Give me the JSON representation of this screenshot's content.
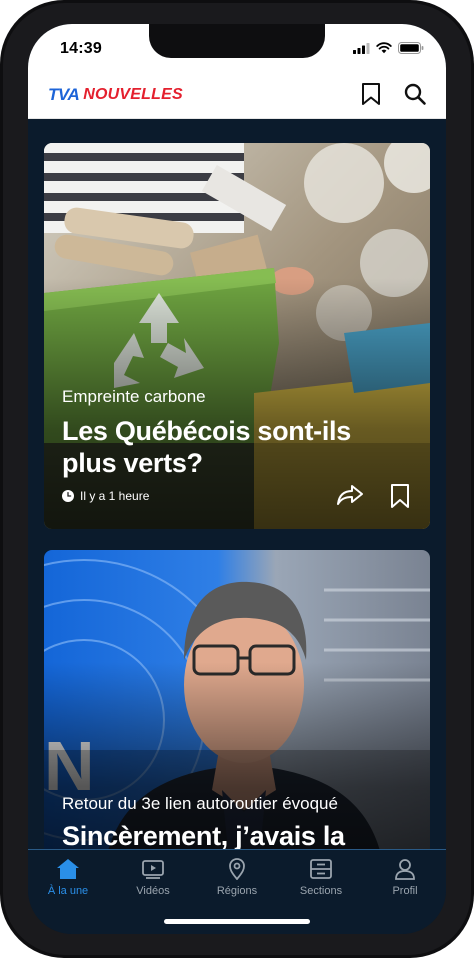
{
  "status": {
    "time": "14:39"
  },
  "brand": {
    "tva": "TVA",
    "nouvelles": "NOUVELLES"
  },
  "appbar": {
    "bookmark_icon": "bookmark-icon",
    "search_icon": "search-icon"
  },
  "articles": [
    {
      "kicker": "Empreinte carbone",
      "title": "Les Québécois sont-ils plus verts?",
      "time_ago": "Il y a 1 heure"
    },
    {
      "kicker": "Retour du 3e lien autoroutier évoqué",
      "title": "Sincèrement, j’avais la"
    }
  ],
  "tabs": [
    {
      "label": "À la une",
      "icon": "home-icon",
      "active": true
    },
    {
      "label": "Vidéos",
      "icon": "video-icon"
    },
    {
      "label": "Régions",
      "icon": "location-pin-icon"
    },
    {
      "label": "Sections",
      "icon": "sections-icon"
    },
    {
      "label": "Profil",
      "icon": "profile-icon"
    }
  ],
  "colors": {
    "brand_blue": "#1d64d8",
    "brand_red": "#e4202e",
    "tab_active": "#2a8fe8",
    "nav_bg": "#0b1b2c"
  }
}
